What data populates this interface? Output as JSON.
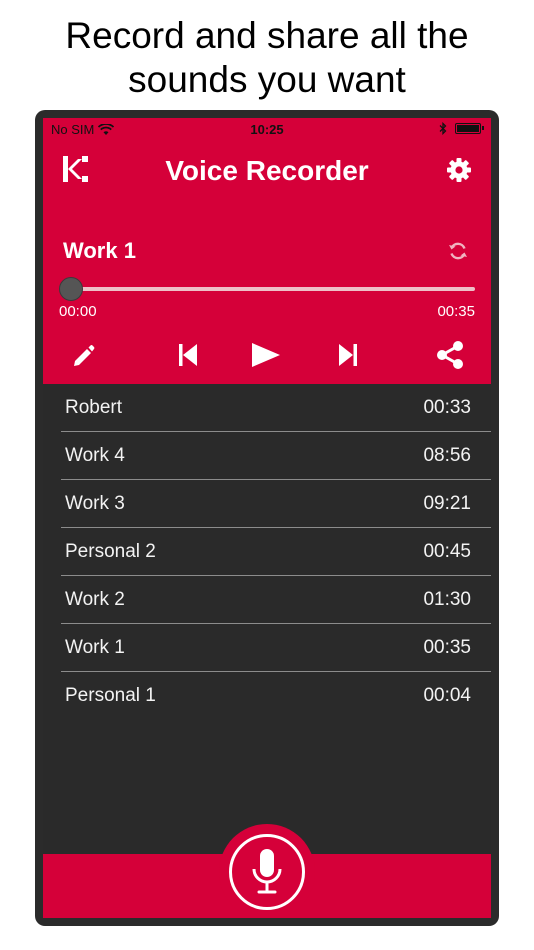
{
  "headline": {
    "line1": "Record and share all the",
    "line2": "sounds you want"
  },
  "status": {
    "carrier": "No SIM",
    "time": "10:25"
  },
  "appbar": {
    "title": "Voice Recorder"
  },
  "player": {
    "track_title": "Work 1",
    "current_time": "00:00",
    "total_time": "00:35",
    "progress": 0
  },
  "recordings": [
    {
      "name": "Robert",
      "duration": "00:33"
    },
    {
      "name": "Work 4",
      "duration": "08:56"
    },
    {
      "name": "Work 3",
      "duration": "09:21"
    },
    {
      "name": "Personal 2",
      "duration": "00:45"
    },
    {
      "name": "Work 2",
      "duration": "01:30"
    },
    {
      "name": "Work 1",
      "duration": "00:35"
    },
    {
      "name": "Personal 1",
      "duration": "00:04"
    }
  ],
  "colors": {
    "accent": "#d50039",
    "background": "#2a2a2a",
    "text": "#ffffff"
  },
  "icons": [
    "wifi-icon",
    "bluetooth-icon",
    "battery-icon",
    "app-logo-icon",
    "gear-icon",
    "refresh-icon",
    "pencil-icon",
    "skip-previous-icon",
    "play-icon",
    "skip-next-icon",
    "share-icon",
    "microphone-icon"
  ]
}
